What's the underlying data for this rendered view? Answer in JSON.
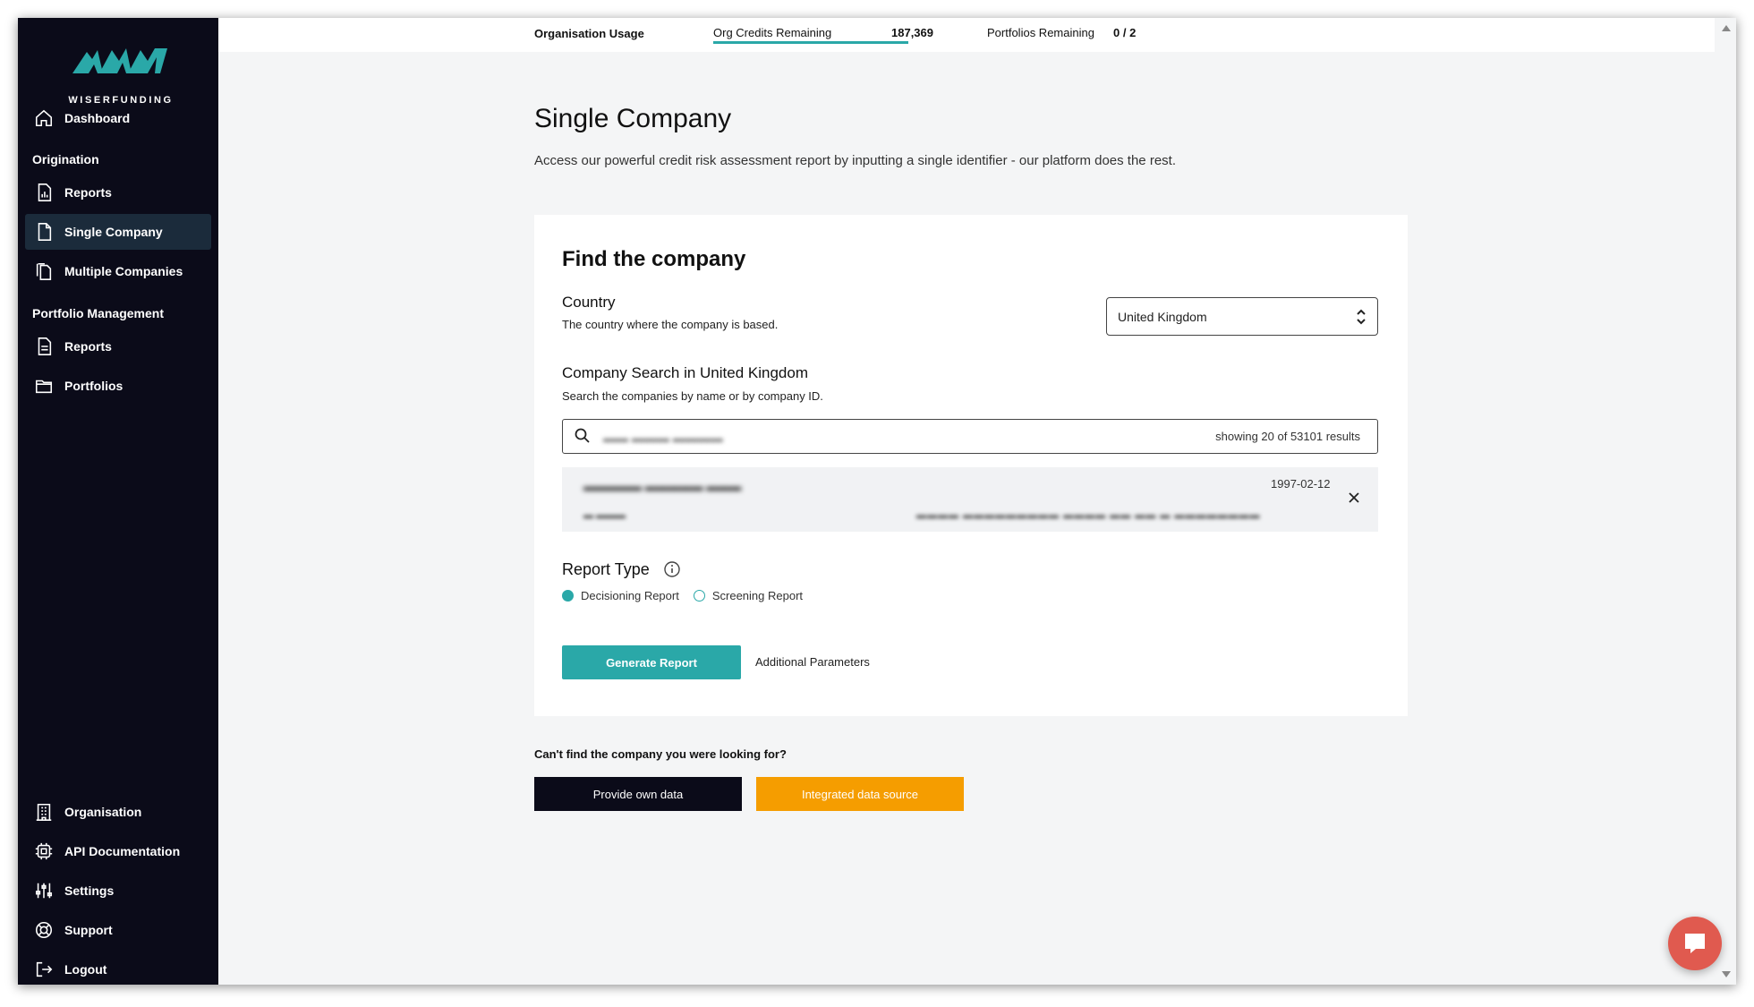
{
  "brand": {
    "name": "WISERFUNDING",
    "accent": "#2aa8a8",
    "sidebar_bg": "#0b0b19",
    "orange": "#f59d00"
  },
  "sidebar": {
    "dashboard": "Dashboard",
    "origination_section": "Origination",
    "origination_reports": "Reports",
    "single_company": "Single Company",
    "multiple_companies": "Multiple Companies",
    "portfolio_section": "Portfolio Management",
    "portfolio_reports": "Reports",
    "portfolios": "Portfolios",
    "organisation": "Organisation",
    "api_docs": "API Documentation",
    "settings": "Settings",
    "support": "Support",
    "logout": "Logout"
  },
  "topbar": {
    "usage_title": "Organisation Usage",
    "credits_label": "Org Credits Remaining",
    "credits_value": "187,369",
    "portfolios_label": "Portfolios Remaining",
    "portfolios_value": "0 / 2"
  },
  "page": {
    "title": "Single Company",
    "description": "Access our powerful credit risk assessment report by inputting a single identifier - our platform does the rest."
  },
  "card": {
    "title": "Find the company",
    "country_label": "Country",
    "country_sub": "The country where the company is based.",
    "country_value": "United Kingdom",
    "search_label": "Company Search in United Kingdom",
    "search_sub": "Search the companies by name or by company ID.",
    "search_query": "▬▬ ▬▬▬ ▬▬▬▬",
    "search_count": "showing 20 of 53101 results",
    "result": {
      "name": "▬▬▬▬▬ ▬▬▬▬▬ ▬▬▬",
      "id": "▬ ▬▬▬",
      "address": "▬▬▬▬ ▬▬▬▬▬▬▬▬▬ ▬▬▬▬ ▬▬ ▬▬ ▬ ▬▬▬▬▬▬▬▬",
      "date": "1997-02-12"
    },
    "report_type_label": "Report Type",
    "option_decisioning": "Decisioning Report",
    "option_screening": "Screening Report",
    "generate_button": "Generate Report",
    "additional_parameters": "Additional Parameters"
  },
  "footer": {
    "cant_find": "Can't find the company you were looking for?",
    "provide_own_data": "Provide own data",
    "integrated_source": "Integrated data source"
  }
}
